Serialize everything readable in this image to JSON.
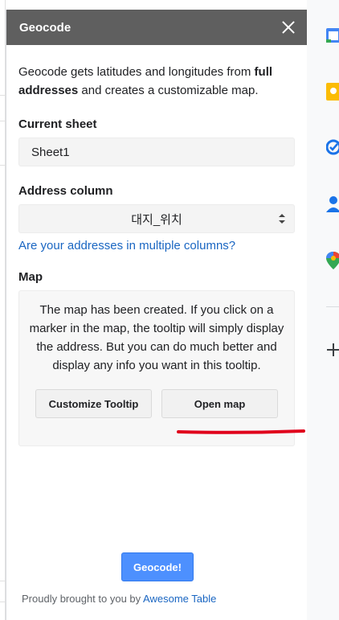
{
  "panel": {
    "title": "Geocode",
    "intro_part1": "Geocode gets latitudes and longitudes from ",
    "intro_bold": "full addresses",
    "intro_part2": " and creates a customizable map."
  },
  "current_sheet": {
    "label": "Current sheet",
    "value": "Sheet1"
  },
  "address_column": {
    "label": "Address column",
    "selected": "대지_위치",
    "link": "Are your addresses in multiple columns?"
  },
  "map": {
    "label": "Map",
    "description": "The map has been created. If you click on a marker in the map, the tooltip will simply display the address. But you can do much better and display any info you want in this tooltip.",
    "customize_button": "Customize Tooltip",
    "open_button": "Open map"
  },
  "actions": {
    "geocode_button": "Geocode!"
  },
  "footer": {
    "text": "Proudly brought to you by ",
    "link": "Awesome Table"
  },
  "colors": {
    "header_bg": "#5f5f5f",
    "link": "#1a66c2",
    "primary_button": "#4d90fe",
    "annotation": "#e0001b"
  },
  "sidebar_icons": [
    "calendar-icon",
    "keep-icon",
    "tasks-icon",
    "contacts-icon",
    "maps-icon",
    "add-icon"
  ]
}
